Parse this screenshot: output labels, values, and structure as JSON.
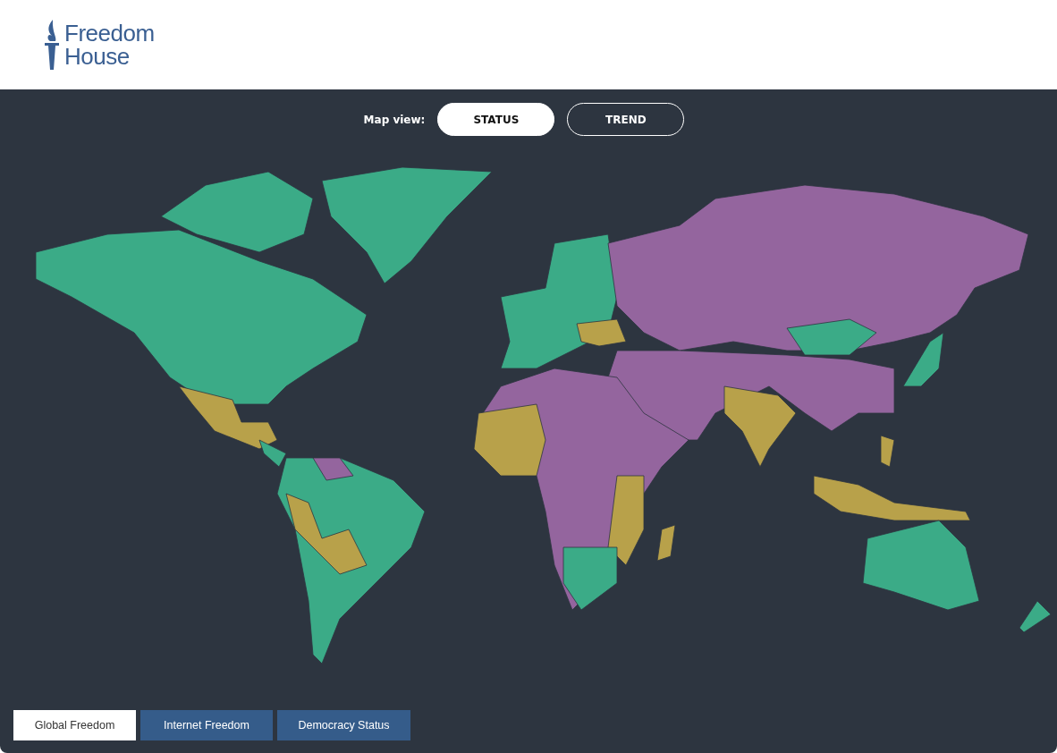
{
  "logo": {
    "line_1": "Freedom",
    "line_2": "House"
  },
  "map_view": {
    "label": "Map view:",
    "options": [
      {
        "label": "STATUS",
        "selected": true
      },
      {
        "label": "TREND",
        "selected": false
      }
    ]
  },
  "tabs": [
    {
      "label": "Global Freedom",
      "selected": true
    },
    {
      "label": "Internet Freedom",
      "selected": false
    },
    {
      "label": "Democracy Status",
      "selected": false
    }
  ]
}
